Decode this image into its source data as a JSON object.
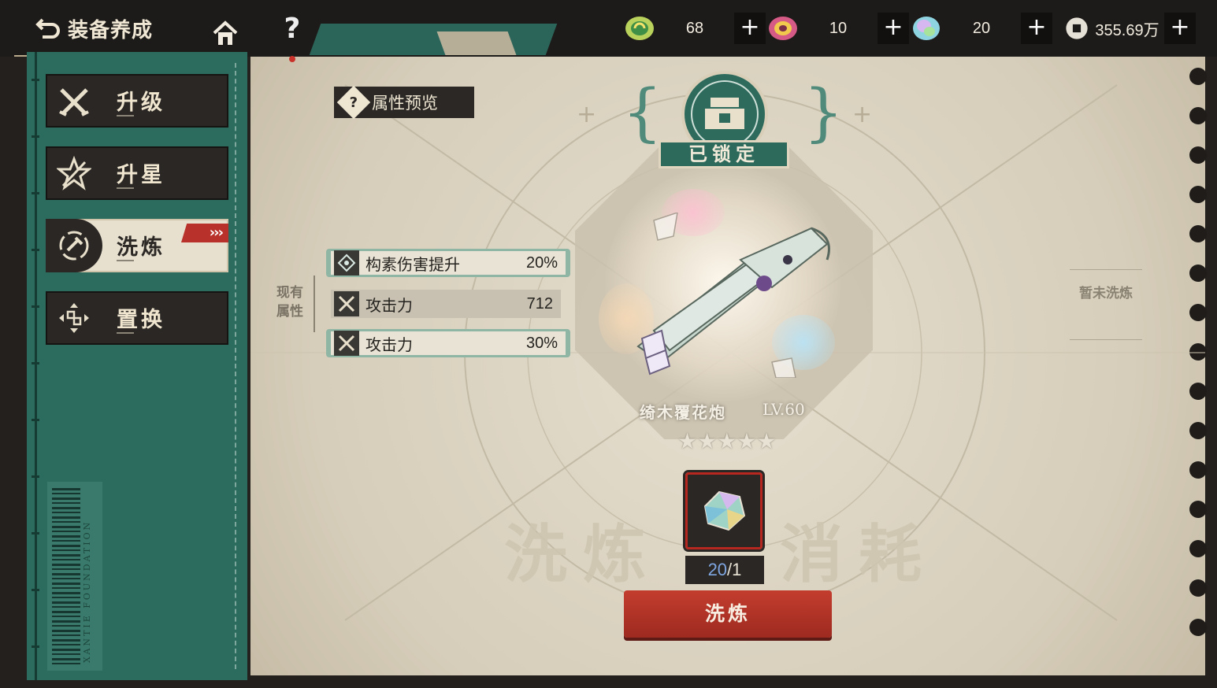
{
  "header": {
    "title": "装备养成",
    "help_label": "?"
  },
  "resources": [
    {
      "name": "resource-1",
      "value": "68",
      "color": "#7cc25a"
    },
    {
      "name": "resource-2",
      "value": "10",
      "color": "#d8557a"
    },
    {
      "name": "resource-3",
      "value": "20",
      "color": "#7bc2d6"
    },
    {
      "name": "currency",
      "value": "355.69万",
      "color": "#e6e1d7"
    }
  ],
  "plus_label": "+",
  "sidebar": {
    "items": [
      {
        "label": "升级",
        "icon": "upgrade-icon",
        "active": false
      },
      {
        "label": "升星",
        "icon": "star-up-icon",
        "active": false
      },
      {
        "label": "洗炼",
        "icon": "refine-icon",
        "active": true
      },
      {
        "label": "置换",
        "icon": "replace-icon",
        "active": false
      }
    ],
    "active_tag": "›››",
    "barcode_text": "XANTIE FOUNDATION"
  },
  "main": {
    "preview_label": "属性预览",
    "preview_icon_label": "?",
    "current_attr_label": "现有属性",
    "attributes": [
      {
        "name": "构素伤害提升",
        "value": "20%",
        "icon": "element-icon"
      },
      {
        "name": "攻击力",
        "value": "712",
        "icon": "crossed-swords-icon"
      },
      {
        "name": "攻击力",
        "value": "30%",
        "icon": "crossed-swords-icon"
      }
    ],
    "not_refined_note": "暂未洗炼",
    "lock_status": "已锁定",
    "weapon": {
      "name": "绮木覆花炮",
      "level": "LV.60",
      "stars": 5
    },
    "cost": {
      "have": "20",
      "need": "1",
      "separator": "/"
    },
    "refine_button": "洗炼",
    "bg_words": [
      "洗炼",
      "消耗"
    ]
  }
}
